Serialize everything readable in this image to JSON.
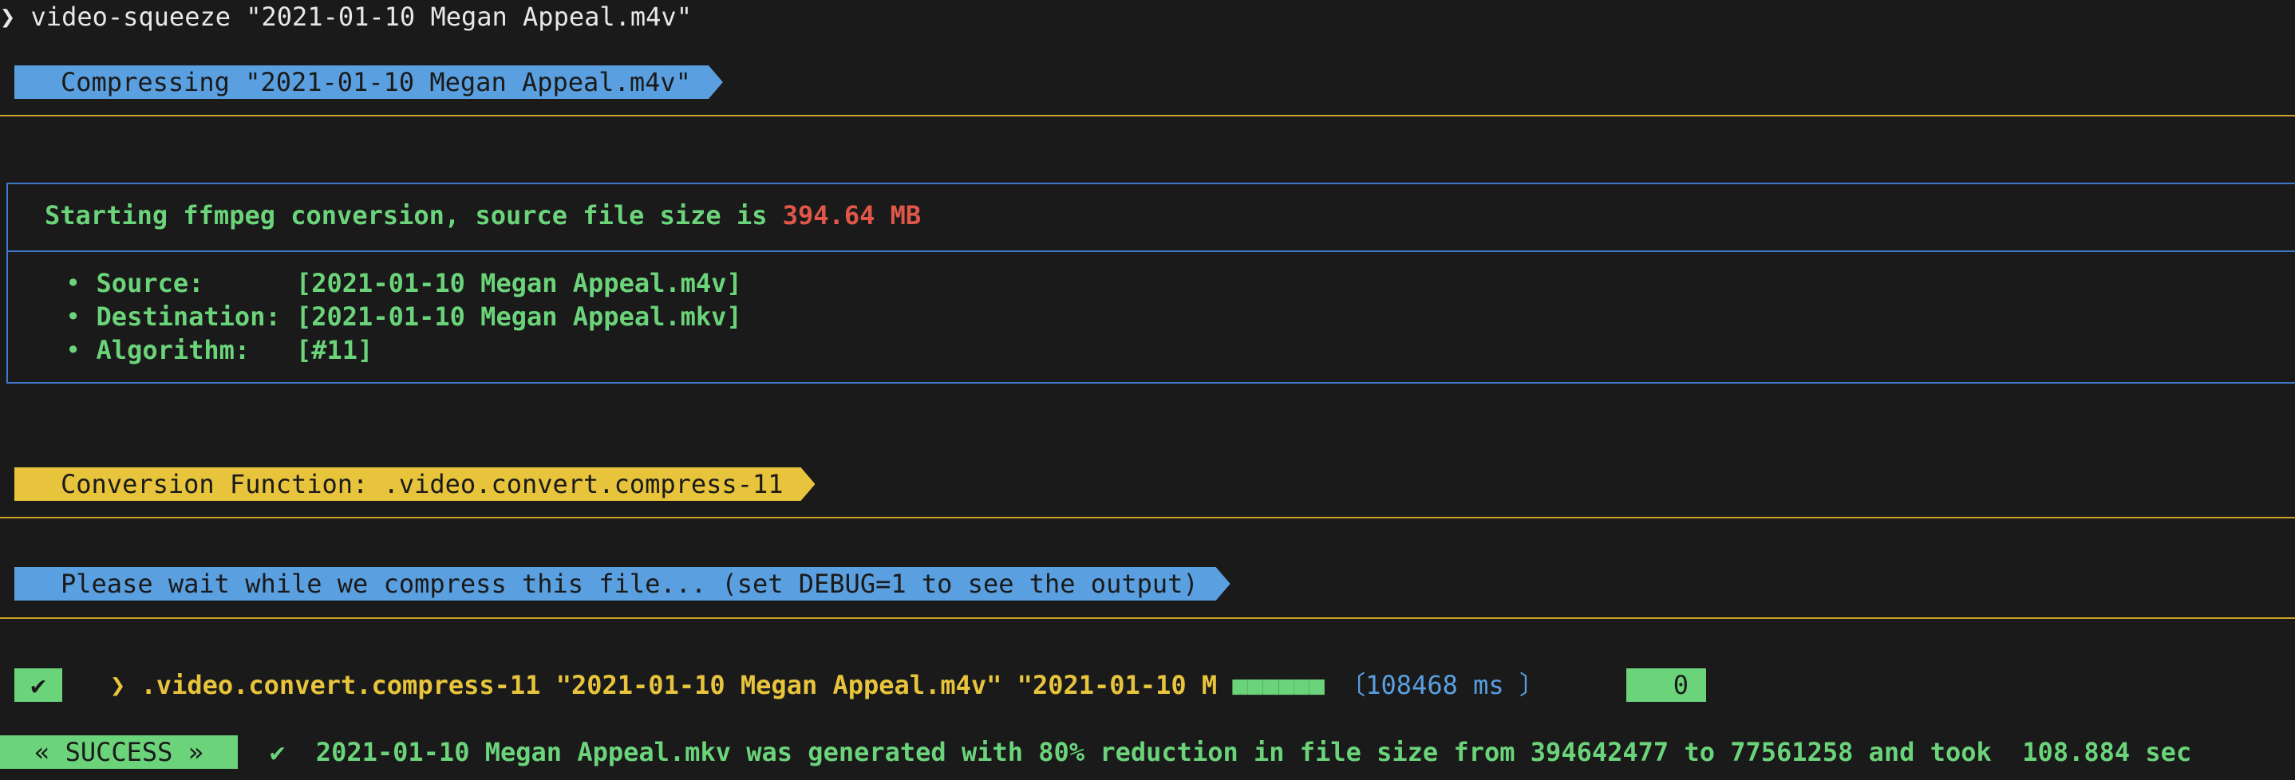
{
  "prompt": {
    "symbol": "❯",
    "command": "video-squeeze \"2021-01-10 Megan Appeal.m4v\""
  },
  "banner_compressing": "Compressing \"2021-01-10 Megan Appeal.m4v\"",
  "box": {
    "heading_prefix": "Starting ffmpeg conversion, source file size is ",
    "heading_size": "394.64 MB",
    "items": [
      {
        "bullet": "•",
        "label": "Source:      ",
        "value": "[2021-01-10 Megan Appeal.m4v]"
      },
      {
        "bullet": "•",
        "label": "Destination: ",
        "value": "[2021-01-10 Megan Appeal.mkv]"
      },
      {
        "bullet": "•",
        "label": "Algorithm:   ",
        "value": "[#11]"
      }
    ]
  },
  "banner_function": "Conversion Function: .video.convert.compress-11",
  "banner_wait": "Please wait while we compress this file... (set DEBUG=1 to see the output)",
  "run": {
    "check": "✔",
    "arrow": "❯",
    "command": ".video.convert.compress-11 \"2021-01-10 Megan Appeal.m4v\" \"2021-01-10 M",
    "progress": "■■■■■■",
    "timing_open": "〔",
    "timing": "108468 ms",
    "timing_close": "〕",
    "exit_code": "0"
  },
  "result": {
    "badge": "« SUCCESS »",
    "check": "✔",
    "message": "2021-01-10 Megan Appeal.mkv was generated with 80% reduction in file size from 394642477 to 77561258 and took  108.884 sec"
  },
  "colors": {
    "background": "#1a1a1a",
    "blue": "#5a9fe0",
    "yellow": "#e8c43c",
    "green": "#6bd47a",
    "red": "#e0574a"
  }
}
